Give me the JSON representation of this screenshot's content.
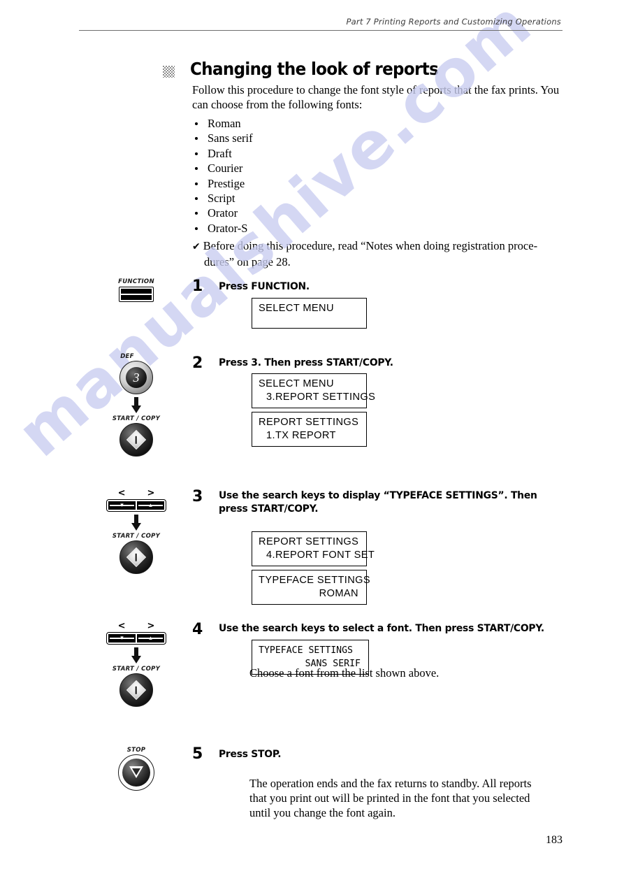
{
  "header": {
    "part": "Part 7",
    "title": "Printing Reports and Customizing Operations",
    "full": "Part 7   Printing Reports and Customizing Operations"
  },
  "section": {
    "title": "Changing the look of reports",
    "intro": "Follow this procedure to change the font style of reports that the fax prints. You can choose from the following fonts:",
    "font_list": [
      "Roman",
      "Sans serif",
      "Draft",
      "Courier",
      "Prestige",
      "Script",
      "Orator",
      "Orator-S"
    ],
    "note": {
      "mark": "✔",
      "text": "Before doing this procedure, read “Notes when doing registration proce-dures” on page 28."
    }
  },
  "steps": [
    {
      "number": "1",
      "instruction": "Press FUNCTION.",
      "keys": [
        {
          "type": "function-key",
          "caption": "FUNCTION"
        }
      ],
      "displays": [
        {
          "lines": [
            {
              "text": "SELECT MENU",
              "align": "left"
            }
          ],
          "tall": true
        }
      ],
      "body": ""
    },
    {
      "number": "2",
      "instruction": "Press 3. Then press START/COPY.",
      "keys": [
        {
          "type": "digit-key",
          "caption": "DEF",
          "digit": "3"
        },
        {
          "type": "start-key",
          "caption": "START / COPY"
        }
      ],
      "displays": [
        {
          "lines": [
            {
              "text": "SELECT MENU",
              "align": "left"
            },
            {
              "text": "3.REPORT SETTINGS",
              "align": "indent"
            }
          ]
        },
        {
          "lines": [
            {
              "text": "REPORT SETTINGS",
              "align": "left"
            },
            {
              "text": "1.TX REPORT",
              "align": "indent"
            }
          ]
        }
      ],
      "body": ""
    },
    {
      "number": "3",
      "instruction": "Use the search keys to display “TYPEFACE SETTINGS”. Then press START/COPY.",
      "keys": [
        {
          "type": "search-key",
          "caption": "",
          "left_label": "<",
          "right_label": ">"
        },
        {
          "type": "start-key",
          "caption": "START / COPY"
        }
      ],
      "displays": [
        {
          "lines": [
            {
              "text": "REPORT SETTINGS",
              "align": "left"
            },
            {
              "text": "4.REPORT FONT SET",
              "align": "indent"
            }
          ]
        },
        {
          "lines": [
            {
              "text": "TYPEFACE SETTINGS",
              "align": "left"
            },
            {
              "text": "ROMAN",
              "align": "right"
            }
          ]
        }
      ],
      "body": ""
    },
    {
      "number": "4",
      "instruction": "Use the search keys to select a font. Then press START/COPY.",
      "keys": [
        {
          "type": "search-key",
          "caption": "",
          "left_label": "<",
          "right_label": ">"
        },
        {
          "type": "start-key",
          "caption": "START / COPY"
        }
      ],
      "displays": [
        {
          "degraded": true,
          "lines": [
            {
              "text": "TYPEFACE SETTINGS",
              "align": "left"
            },
            {
              "text": "SANS SERIF",
              "align": "right"
            }
          ]
        }
      ],
      "body": "Choose a font from the list shown above."
    },
    {
      "number": "5",
      "instruction": "Press STOP.",
      "keys": [
        {
          "type": "stop-key",
          "caption": "STOP"
        }
      ],
      "displays": [],
      "body": "The operation ends and the fax returns to standby. All reports that you print out will be printed in the font that you selected until you change the font again."
    }
  ],
  "watermark": {
    "text": "manualshive.com"
  },
  "page_number": "183"
}
